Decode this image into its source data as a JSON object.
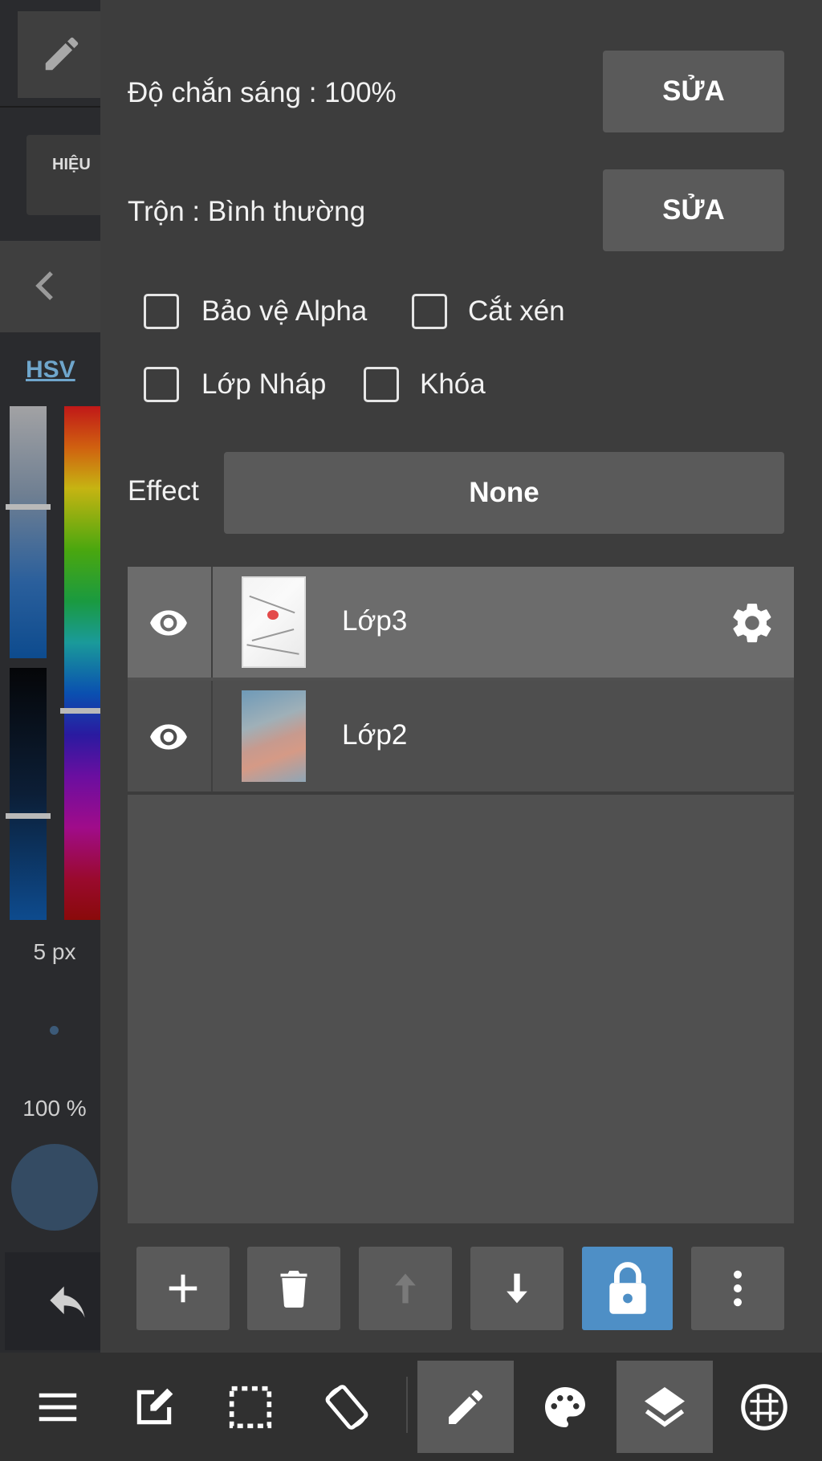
{
  "left_panel": {
    "effect_short": "HIỆU",
    "color_mode": "HSV",
    "brush_size": "5 px",
    "opacity": "100 %"
  },
  "layer_props": {
    "opacity_label": "Độ chắn sáng : 100%",
    "blend_label": "Trộn : Bình thường",
    "edit_label": "SỬA",
    "checkboxes": [
      {
        "label": "Bảo vệ Alpha",
        "checked": false
      },
      {
        "label": "Cắt xén",
        "checked": false
      },
      {
        "label": "Lớp Nháp",
        "checked": false
      },
      {
        "label": "Khóa",
        "checked": false
      }
    ],
    "effect_label": "Effect",
    "effect_value": "None"
  },
  "layers": [
    {
      "name": "Lớp3",
      "selected": true,
      "visible": true
    },
    {
      "name": "Lớp2",
      "selected": false,
      "visible": true
    }
  ],
  "layer_toolbar": [
    "plus-icon",
    "trash-icon",
    "arrow-up-icon",
    "arrow-down-icon",
    "lock-icon",
    "more-vertical-icon"
  ],
  "bottom_bar": [
    "menu-icon",
    "edit-note-icon",
    "selection-icon",
    "rotate-icon",
    "pen-icon",
    "palette-icon",
    "layers-icon",
    "grid-icon"
  ],
  "colors": {
    "accent": "#4e8fc6",
    "hsv_link": "#6fa6cc",
    "panel": "#3d3d3d",
    "button": "#5a5a5a"
  }
}
